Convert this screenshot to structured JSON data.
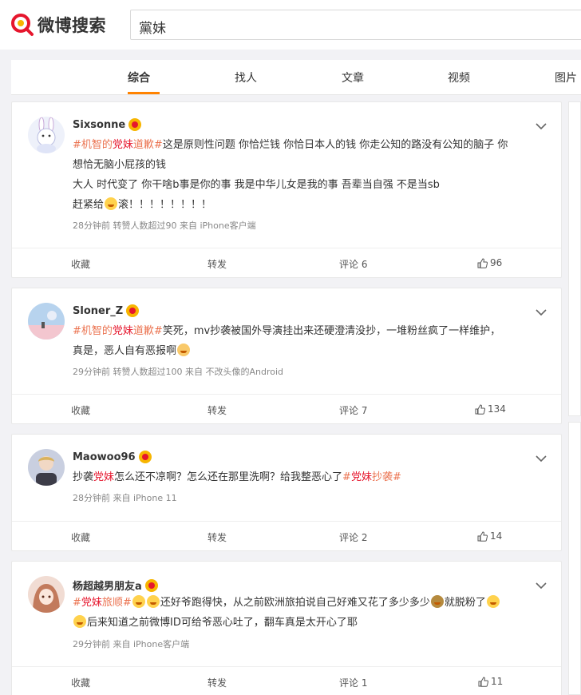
{
  "header": {
    "logo_text": "微博搜索",
    "search_value": "黨妹"
  },
  "tabs": [
    {
      "label": "综合",
      "active": true
    },
    {
      "label": "找人",
      "active": false
    },
    {
      "label": "文章",
      "active": false
    },
    {
      "label": "视频",
      "active": false
    },
    {
      "label": "图片",
      "active": false
    }
  ],
  "posts": [
    {
      "user": "Sixsonne",
      "lines": [
        [
          "#机智的",
          "党妹",
          "道歉#",
          "这是原则性问题 你恰烂钱 你恰日本人的钱 你走公知的路没有公知的脑子 你"
        ],
        "想恰无脑小屁孩的钱",
        "大人 时代变了 你干啥b事是你的事 我是中华儿女是我的事 吾辈当自强 不是当sb",
        "赶紧给",
        "滚！！！！！！！！"
      ],
      "meta": "28分钟前  转赞人数超过90  来自 iPhone客户端",
      "actions": {
        "fav": "收藏",
        "repost": "转发",
        "comment": "评论 6",
        "like": "96"
      }
    },
    {
      "user": "Sloner_Z",
      "line1_tag_a": "#机智的",
      "line1_tag_b": "党妹",
      "line1_tag_c": "道歉#",
      "line1_rest": "笑死，mv抄袭被国外导演挂出来还硬澄清没抄，一堆粉丝疯了一样维护，",
      "line2": "真是，恶人自有恶报啊",
      "meta": "29分钟前  转赞人数超过100  来自 不改头像的Android",
      "actions": {
        "fav": "收藏",
        "repost": "转发",
        "comment": "评论 7",
        "like": "134"
      }
    },
    {
      "user": "Maowoo96",
      "t_a": "抄袭",
      "t_b": "党妹",
      "t_c": "怎么还不凉啊？怎么还在那里洗啊？给我整恶心了",
      "t_d": "#",
      "t_e": "党妹",
      "t_f": "抄袭#",
      "meta": "28分钟前  来自 iPhone 11",
      "actions": {
        "fav": "收藏",
        "repost": "转发",
        "comment": "评论 2",
        "like": "14"
      }
    },
    {
      "user": "杨超越男朋友a",
      "t_a": "#",
      "t_b": "党妹",
      "t_c": "旅顺#",
      "t_d": "还好爷跑得快，从之前欧洲旅拍说自己好难又花了多少多少",
      "t_e": "就脱粉了",
      "line2": "后来知道之前微博ID可给爷恶心吐了，翻车真是太开心了耶",
      "meta": "29分钟前  来自 iPhone客户端",
      "actions": {
        "fav": "收藏",
        "repost": "转发",
        "comment": "评论 1",
        "like": "11"
      }
    }
  ],
  "colors": {
    "accent": "#ff8200",
    "hashtag": "#eb7350",
    "highlight": "#e6162d",
    "logo_red": "#e6162d"
  }
}
